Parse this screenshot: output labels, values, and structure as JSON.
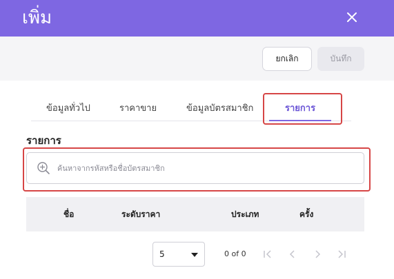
{
  "dialog": {
    "title": "เพิ่ม",
    "close_icon": "close-icon"
  },
  "toolbar": {
    "cancel_label": "ยกเลิก",
    "save_label": "บันทึก"
  },
  "tabs": [
    {
      "label": "ข้อมูลทั่วไป",
      "active": false
    },
    {
      "label": "ราคาขาย",
      "active": false
    },
    {
      "label": "ข้อมูลบัตรสมาชิก",
      "active": false
    },
    {
      "label": "รายการ",
      "active": true
    }
  ],
  "section": {
    "label": "รายการ"
  },
  "search": {
    "placeholder": "ค้นหาจากรหัสหรือชื่อบัตรสมาชิก",
    "icon": "zoom-in-icon"
  },
  "table": {
    "columns": [
      "ชื่อ",
      "ระดับราคา",
      "ประเภท",
      "ครั้ง"
    ],
    "rows": []
  },
  "pagination": {
    "rows_per_page": "5",
    "range_text": "0 of 0"
  },
  "colors": {
    "header": "#7e67e2",
    "accent": "#6b55d6",
    "highlight": "#d64545"
  }
}
